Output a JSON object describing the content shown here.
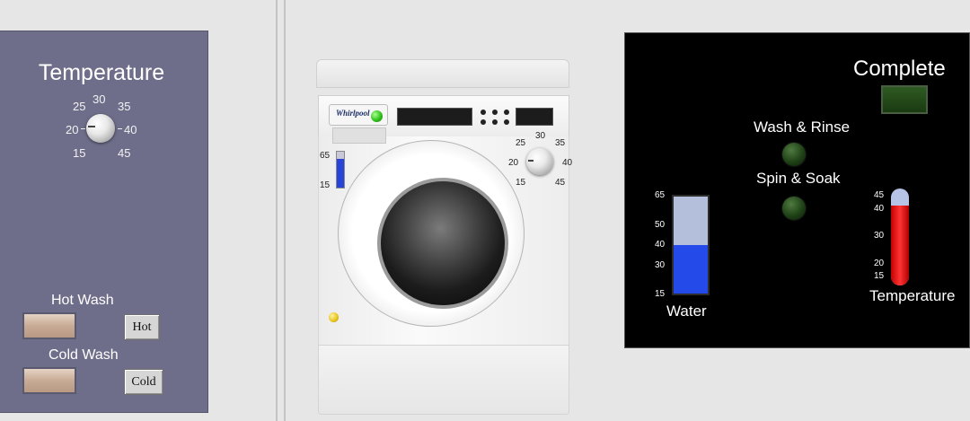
{
  "left_panel": {
    "title": "Temperature",
    "knob_ticks": [
      "15",
      "20",
      "25",
      "30",
      "35",
      "40",
      "45"
    ],
    "hot_wash_label": "Hot Wash",
    "hot_button_label": "Hot",
    "cold_wash_label": "Cold Wash",
    "cold_button_label": "Cold"
  },
  "washer": {
    "brand": "Whirlpool",
    "level_ticks": [
      "65",
      "15"
    ],
    "knob_ticks": [
      "15",
      "20",
      "25",
      "30",
      "35",
      "40",
      "45"
    ],
    "level_fraction": 0.8
  },
  "status_panel": {
    "complete_label": "Complete",
    "wash_rinse_label": "Wash & Rinse",
    "spin_soak_label": "Spin & Soak",
    "water": {
      "label": "Water",
      "ticks": [
        "65",
        "50",
        "40",
        "30",
        "15"
      ],
      "level": 40,
      "min": 15,
      "max": 65
    },
    "temperature": {
      "label": "Temperature",
      "ticks": [
        "45",
        "40",
        "30",
        "20",
        "15"
      ],
      "level": 40,
      "min": 15,
      "max": 45
    }
  },
  "colors": {
    "panel_bg": "#6e6e8a",
    "status_bg": "#000000",
    "water_fill": "#244aea",
    "thermo_fill": "#ff2a2a",
    "led_off": "#1f4216"
  }
}
